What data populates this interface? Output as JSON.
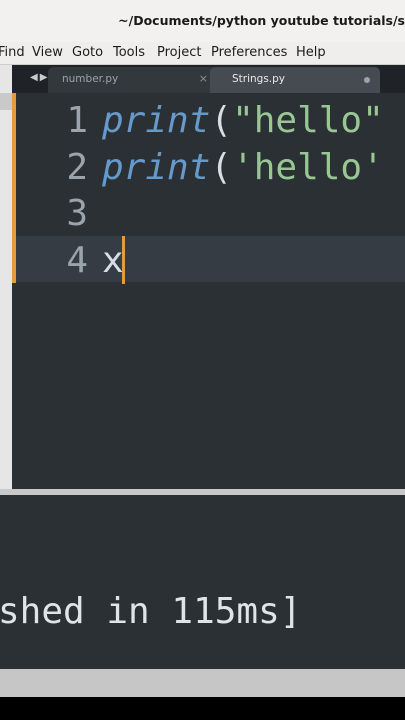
{
  "window": {
    "title": "~/Documents/python youtube tutorials/s"
  },
  "menu": [
    "Find",
    "View",
    "Goto",
    "Tools",
    "Project",
    "Preferences",
    "Help"
  ],
  "tabs": [
    {
      "name": "number.py",
      "close": "×",
      "active": false
    },
    {
      "name": "Strings.py",
      "active": true,
      "modified": true
    }
  ],
  "nav_arrows": "◀▶",
  "editor": {
    "lines": [
      {
        "num": "1",
        "fn": "print",
        "open": "(",
        "str": "\"hello\""
      },
      {
        "num": "2",
        "fn": "print",
        "open": "(",
        "str": "'hello'"
      },
      {
        "num": "3"
      },
      {
        "num": "4",
        "text": "x"
      }
    ]
  },
  "output": {
    "text": "shed in 115ms]"
  },
  "colors": {
    "accent": "#e49b3c",
    "keyword": "#6699cc",
    "string": "#99c794",
    "background": "#2b3035"
  }
}
